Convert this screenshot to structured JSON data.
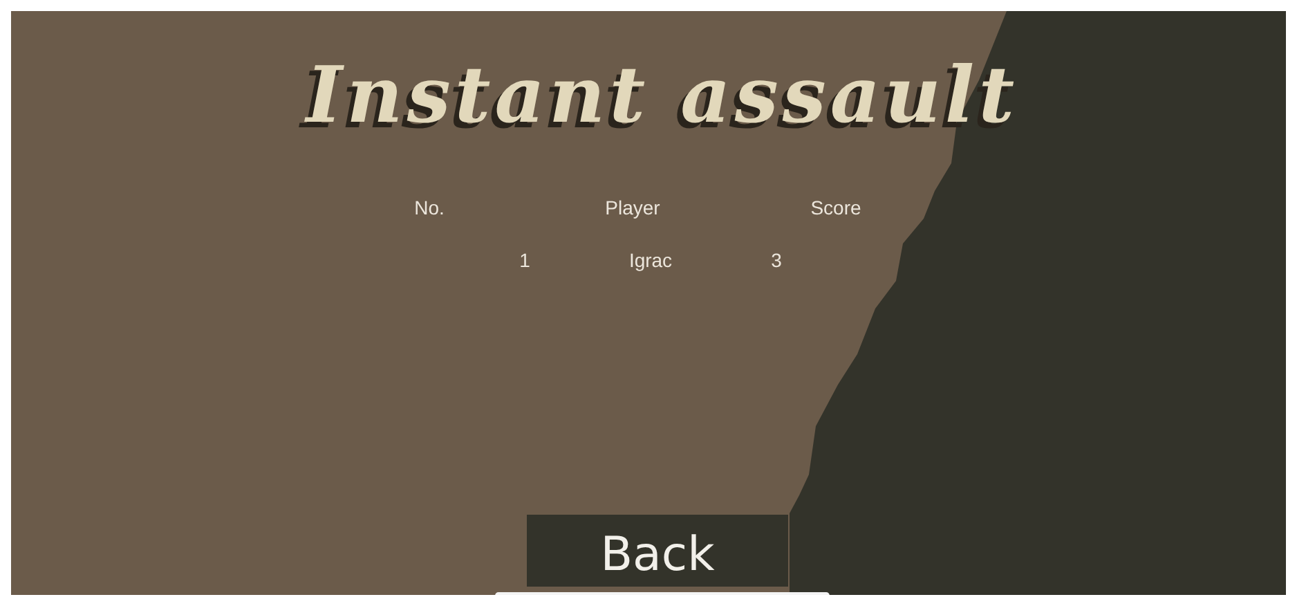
{
  "title": "Instant assault",
  "table": {
    "columns": [
      "No.",
      "Player",
      "Score"
    ],
    "rows": [
      [
        "1",
        "Igrac",
        "3"
      ]
    ]
  },
  "back_button": "Back"
}
